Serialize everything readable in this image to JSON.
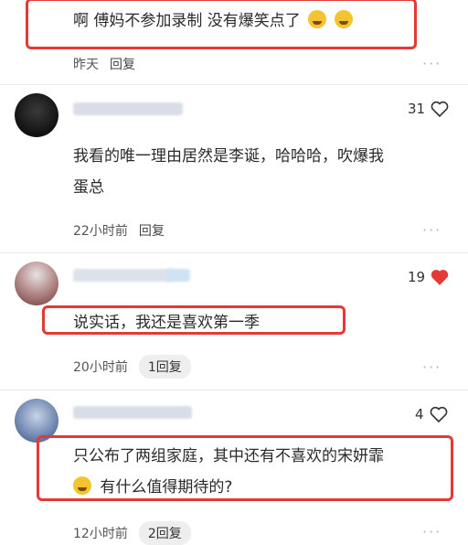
{
  "comments": [
    {
      "text": "啊 傅妈不参加录制 没有爆笑点了",
      "meta": {
        "time": "昨天",
        "reply": "回复"
      }
    },
    {
      "likes": "31",
      "text_line1": "我看的唯一理由居然是李诞，哈哈哈，吹爆我",
      "text_line2": "蛋总",
      "meta": {
        "time": "22小时前",
        "reply": "回复"
      }
    },
    {
      "likes": "19",
      "liked": true,
      "text": "说实话，我还是喜欢第一季",
      "meta": {
        "time": "20小时前",
        "reply_count": "1回复"
      }
    },
    {
      "likes": "4",
      "text_line1": "只公布了两组家庭，其中还有不喜欢的宋妍霏",
      "text_line2": "有什么值得期待的?",
      "meta": {
        "time": "12小时前",
        "reply_count": "2回复"
      }
    }
  ],
  "more_icon": "···",
  "colors": {
    "highlight": "#e53935",
    "liked_heart": "#e53935"
  }
}
